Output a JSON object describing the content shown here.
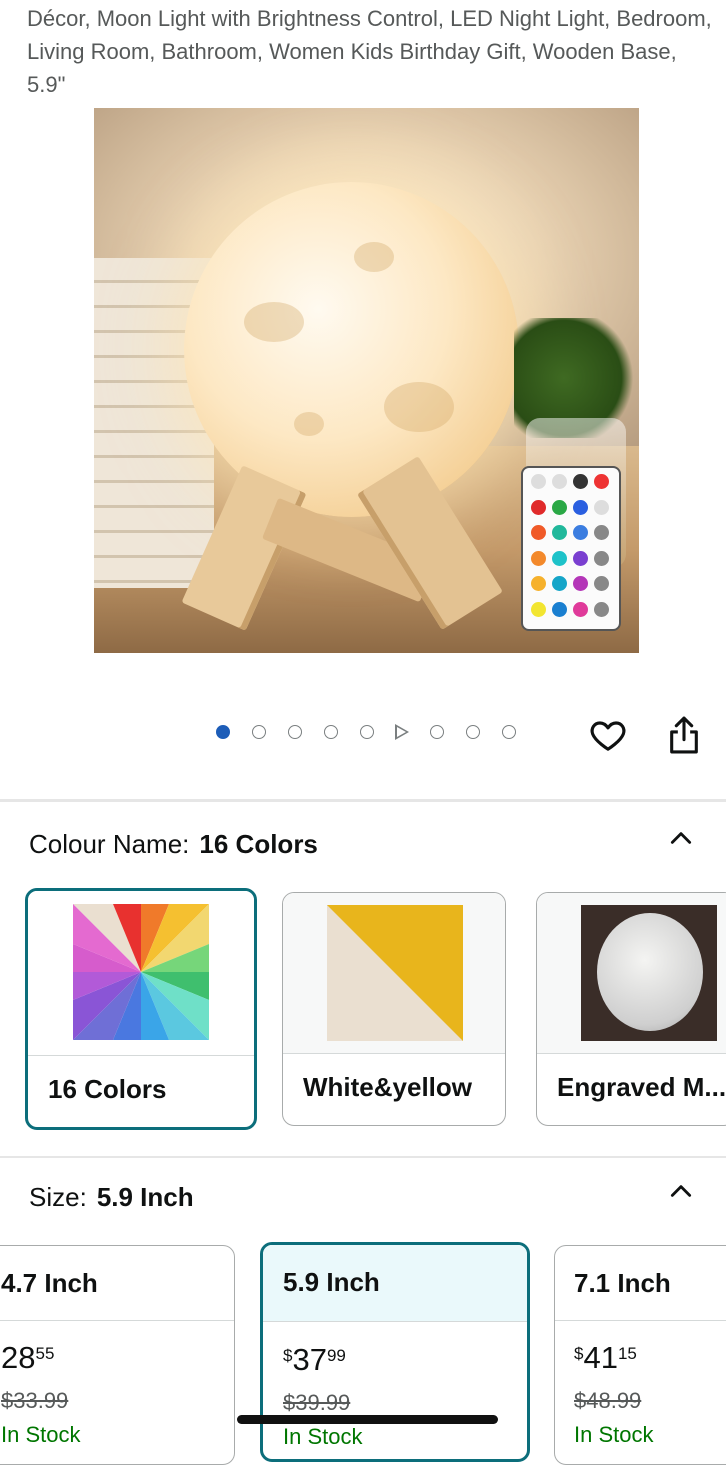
{
  "product": {
    "title": "Décor, Moon Light with Brightness Control, LED Night Light, Bedroom, Living Room, Bathroom, Women Kids Birthday Gift, Wooden Base, 5.9\""
  },
  "gallery": {
    "image_count": 9,
    "active_index": 0,
    "video_index": 5,
    "actions": {
      "wishlist_icon": "heart-icon",
      "share_icon": "share-icon"
    }
  },
  "colour": {
    "label": "Colour Name:",
    "selected": "16 Colors",
    "collapse_icon": "chevron-up-icon",
    "options": [
      {
        "label": "16 Colors",
        "selected": true
      },
      {
        "label": "White&yellow",
        "selected": false
      },
      {
        "label": "Engraved M...",
        "selected": false
      }
    ]
  },
  "size": {
    "label": "Size:",
    "selected": "5.9 Inch",
    "collapse_icon": "chevron-up-icon",
    "options": [
      {
        "name": "4.7 Inch",
        "price_currency": "",
        "price_whole": "28",
        "price_fraction": "55",
        "was": "$33.99",
        "stock": "In Stock",
        "selected": false
      },
      {
        "name": "5.9 Inch",
        "price_currency": "$",
        "price_whole": "37",
        "price_fraction": "99",
        "was": "$39.99",
        "stock": "In Stock",
        "selected": true
      },
      {
        "name": "7.1 Inch",
        "price_currency": "$",
        "price_whole": "41",
        "price_fraction": "15",
        "was": "$48.99",
        "stock": "In Stock",
        "selected": false
      }
    ]
  },
  "colors": {
    "accent_selected": "#0c6e7b",
    "dot_active": "#1d5db8",
    "in_stock": "#007600"
  }
}
